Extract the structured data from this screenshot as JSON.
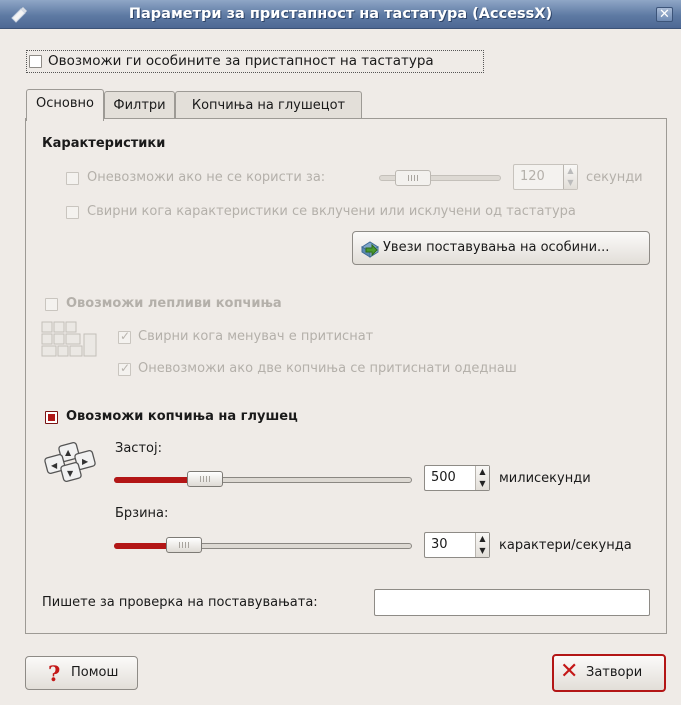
{
  "window": {
    "title": "Параметри за пристапност на тастатура (AccessX)",
    "close_icon": "close-icon",
    "app_icon": "keyboard-accessibility-icon"
  },
  "enable_accessibility": {
    "label": "Овозможи ги особините за пристапност на тастатура",
    "checked": false
  },
  "tabs": [
    {
      "label": "Основно",
      "active": true
    },
    {
      "label": "Филтри",
      "active": false
    },
    {
      "label": "Копчиња на глушецот",
      "active": false
    }
  ],
  "features": {
    "heading": "Карактеристики",
    "disable_unused": {
      "label": "Оневозможи ако не се користи за:",
      "checked": false,
      "enabled": false
    },
    "timeout_slider_value": 120,
    "timeout_value": "120",
    "timeout_unit": "секунди",
    "beep_toggle": {
      "label": "Свирни кога карактеристики се вклучени или исклучени од тастатура",
      "checked": false,
      "enabled": false
    },
    "import_button": "Увези поставувања на особини..."
  },
  "sticky_keys": {
    "label": "Овозможи лепливи копчиња",
    "checked": false,
    "enabled": false,
    "beep_modifier": {
      "label": "Свирни кога менувач е притиснат",
      "checked": true,
      "enabled": false
    },
    "disable_two_keys": {
      "label": "Оневозможи ако две копчиња се притиснати одеднаш",
      "checked": true,
      "enabled": false
    }
  },
  "mouse_keys": {
    "label": "Овозможи копчиња на глушец",
    "checked": true,
    "delay_label": "Застој:",
    "delay_value": "500",
    "delay_fraction": 0.25,
    "delay_unit": "милисекунди",
    "speed_label": "Брзина:",
    "speed_value": "30",
    "speed_fraction": 0.21,
    "speed_unit": "карактери/секунда"
  },
  "test_field": {
    "label": "Пишете за проверка на поставувањата:",
    "value": ""
  },
  "buttons": {
    "help": "Помош",
    "close": "Затвори",
    "help_icon": "help-icon",
    "close_icon": "close-x-icon"
  },
  "colors": {
    "accent": "#b31616",
    "titlebar": "#5e7aa3"
  }
}
